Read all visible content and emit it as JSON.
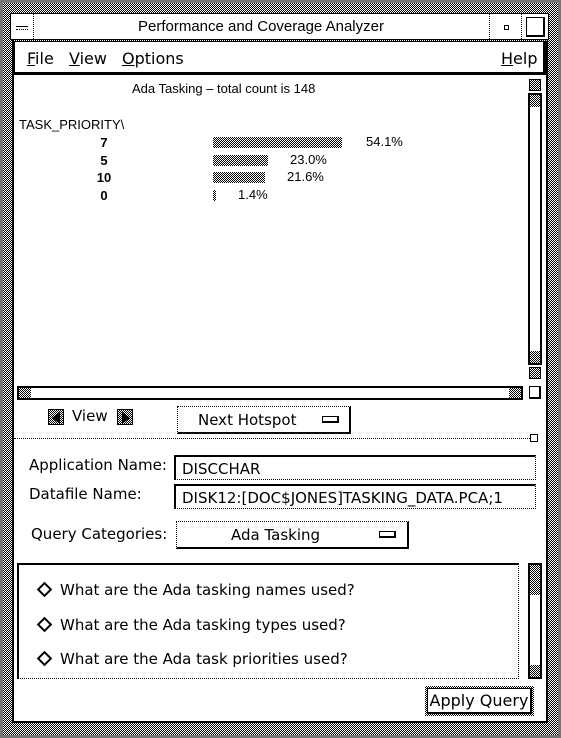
{
  "window": {
    "title": "Performance and Coverage Analyzer"
  },
  "menubar": {
    "items": [
      {
        "label_underlined": "F",
        "label_rest": "ile"
      },
      {
        "label_underlined": "V",
        "label_rest": "iew"
      },
      {
        "label_underlined": "O",
        "label_rest": "ptions"
      },
      {
        "label_underlined": "H",
        "label_rest": "elp"
      }
    ]
  },
  "chart_data": {
    "type": "bar",
    "orientation": "horizontal",
    "title": "Ada Tasking – total count is 148",
    "ylabel": "TASK_PRIORITY\\",
    "xlabel": "",
    "categories": [
      "7",
      "5",
      "10",
      "0"
    ],
    "values": [
      54.1,
      23.0,
      21.6,
      1.4
    ],
    "value_labels": [
      "54.1%",
      "23.0%",
      "21.6%",
      "1.4%"
    ],
    "units": "percent",
    "xlim": [
      0,
      54.1
    ],
    "grid": false,
    "legend": "none",
    "bar_fill": "stipple"
  },
  "view_controls": {
    "view_label": "View",
    "next_hotspot_label": "Next Hotspot"
  },
  "form": {
    "application_name_label": "Application Name:",
    "application_name_value": "DISCCHAR",
    "datafile_name_label": "Datafile Name:",
    "datafile_name_value": "DISK12:[DOC$JONES]TASKING_DATA.PCA;1",
    "query_categories_label": "Query Categories:",
    "query_categories_value": "Ada Tasking"
  },
  "queries": [
    {
      "text": "What are the Ada tasking names used?",
      "selected": false
    },
    {
      "text": "What are the Ada tasking types used?",
      "selected": false
    },
    {
      "text": "What are the Ada task priorities used?",
      "selected": true
    }
  ],
  "actions": {
    "apply_query_label": "Apply Query"
  }
}
